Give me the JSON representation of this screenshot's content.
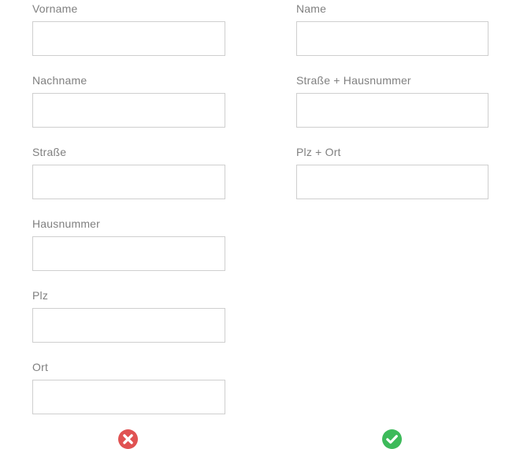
{
  "left_form": {
    "fields": [
      {
        "label": "Vorname",
        "value": "",
        "placeholder": ""
      },
      {
        "label": "Nachname",
        "value": "",
        "placeholder": ""
      },
      {
        "label": "Straße",
        "value": "",
        "placeholder": ""
      },
      {
        "label": "Hausnummer",
        "value": "",
        "placeholder": ""
      },
      {
        "label": "Plz",
        "value": "",
        "placeholder": ""
      },
      {
        "label": "Ort",
        "value": "",
        "placeholder": ""
      }
    ],
    "verdict_icon": "x-circle-icon",
    "verdict_color": "#e05252"
  },
  "right_form": {
    "fields": [
      {
        "label": "Name",
        "value": "",
        "placeholder": ""
      },
      {
        "label": "Straße + Hausnummer",
        "value": "",
        "placeholder": ""
      },
      {
        "label": "Plz + Ort",
        "value": "",
        "placeholder": ""
      }
    ],
    "verdict_icon": "check-circle-icon",
    "verdict_color": "#3dba5a"
  },
  "colors": {
    "label_text": "#808080",
    "input_border": "#cfcfcf",
    "background": "#ffffff"
  }
}
